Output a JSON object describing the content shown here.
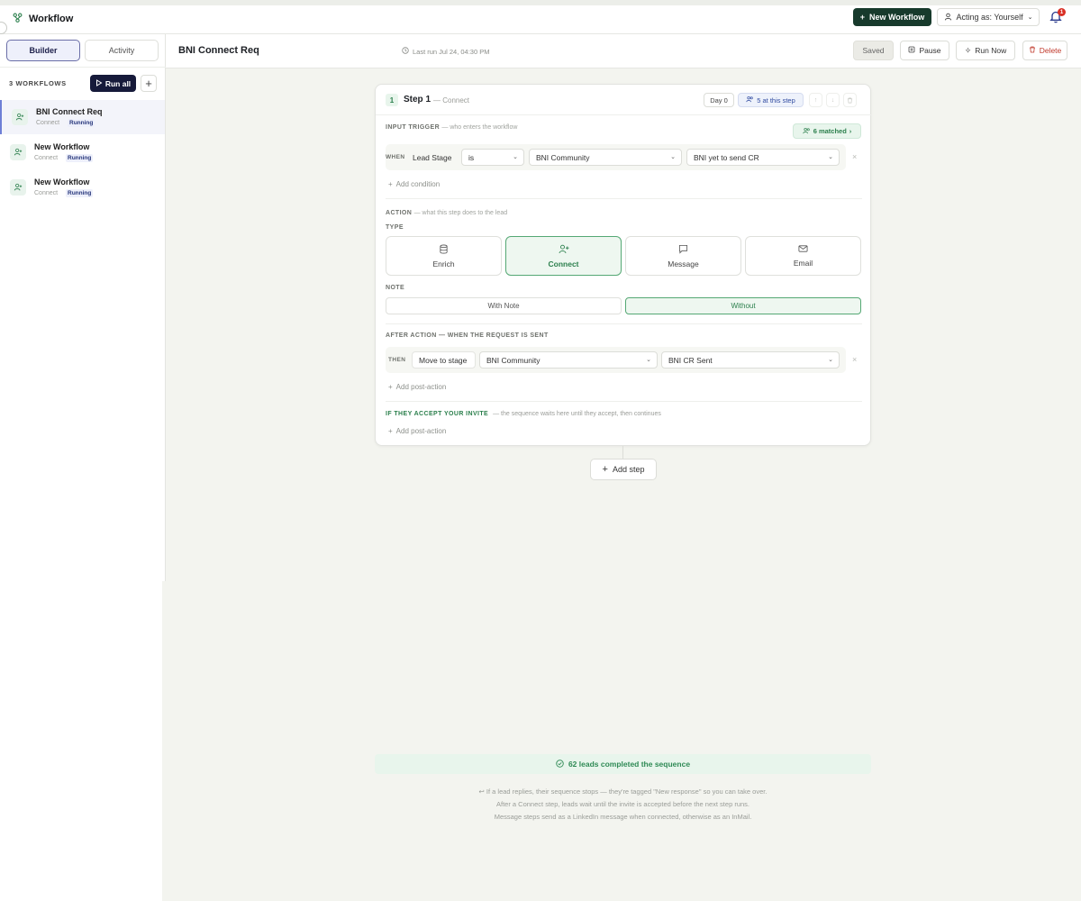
{
  "app": {
    "title": "Workflow"
  },
  "topbar": {
    "new_workflow": "New Workflow",
    "acting_as": "Acting as: Yourself",
    "notifications_count": "1"
  },
  "sidebar": {
    "tabs": [
      "Builder",
      "Activity"
    ],
    "workflows_count": "3 WORKFLOWS",
    "run_all": "Run all",
    "add": "+",
    "items": [
      {
        "name": "BNI Connect Req",
        "type": "Connect",
        "status": "Running"
      },
      {
        "name": "New Workflow",
        "type": "Connect",
        "status": "Running"
      },
      {
        "name": "New Workflow",
        "type": "Connect",
        "status": "Running"
      }
    ]
  },
  "header": {
    "title": "BNI Connect Req",
    "last_run": "Last run Jul 24, 04:30 PM",
    "saved": "Saved",
    "pause": "Pause",
    "run_now": "Run Now",
    "delete": "Delete"
  },
  "step": {
    "number": "1",
    "title": "Step 1",
    "subtitle": "— Connect",
    "day": "Day 0",
    "at_step": "5 at this step",
    "input_trigger_label": "INPUT TRIGGER",
    "input_trigger_sub": "— who enters the workflow",
    "matched": "6 matched",
    "when": "WHEN",
    "condition": {
      "field": "Lead Stage",
      "operator": "is",
      "value1": "BNI Community",
      "value2": "BNI yet to send CR"
    },
    "add_condition": "Add condition",
    "action_label": "ACTION",
    "action_sub": "— what this step does to the lead",
    "type_label": "TYPE",
    "types": [
      "Enrich",
      "Connect",
      "Message",
      "Email"
    ],
    "note_label": "NOTE",
    "note_options": [
      "With Note",
      "Without"
    ],
    "after_action_label": "AFTER ACTION — WHEN THE REQUEST IS SENT",
    "then": "THEN",
    "post_action": {
      "action": "Move to stage",
      "value1": "BNI Community",
      "value2": "BNI CR Sent"
    },
    "add_post_action": "Add post-action",
    "accept_label": "IF THEY ACCEPT YOUR INVITE",
    "accept_sub": "— the sequence waits here until they accept, then continues",
    "add_post_action_2": "Add post-action"
  },
  "add_step": "Add step",
  "completed": "62 leads completed the sequence",
  "notes": [
    "If a lead replies, their sequence stops — they're tagged \"New response\" so you can take over.",
    "After a Connect step, leads wait until the invite is accepted before the next step runs.",
    "Message steps send as a LinkedIn message when connected, otherwise as an InMail."
  ],
  "colors": {
    "accent_green": "#2b7f4c",
    "dark_green": "#173a2c",
    "navy": "#161a3a",
    "delete_red": "#c0392b"
  }
}
